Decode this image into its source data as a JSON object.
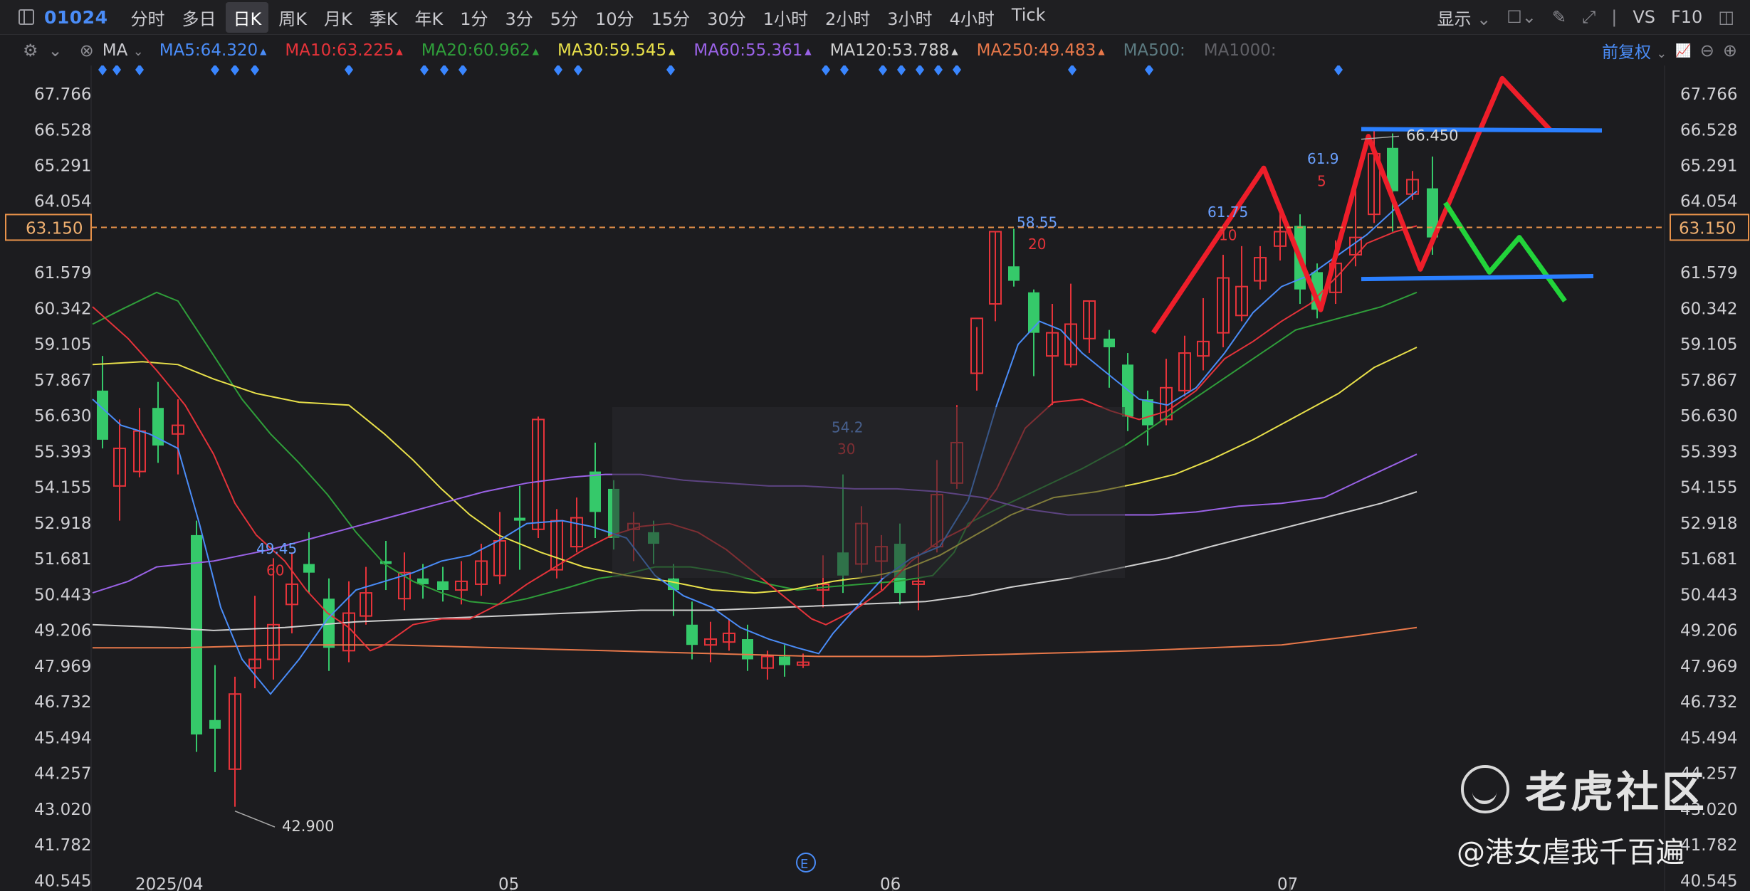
{
  "toolbar": {
    "code": "01024",
    "periods": [
      "分时",
      "多日",
      "日K",
      "周K",
      "月K",
      "季K",
      "年K",
      "1分",
      "3分",
      "5分",
      "10分",
      "15分",
      "30分",
      "1小时",
      "2小时",
      "3小时",
      "4小时",
      "Tick"
    ],
    "active_period": "日K",
    "display_label": "显示",
    "vs_label": "VS",
    "f10_label": "F10"
  },
  "ma_bar": {
    "indicator": "MA",
    "items": [
      {
        "label": "MA5:64.320",
        "color": "#4a8cf7"
      },
      {
        "label": "MA10:63.225",
        "color": "#e5333a"
      },
      {
        "label": "MA20:60.962",
        "color": "#2f9e3a"
      },
      {
        "label": "MA30:59.545",
        "color": "#e8e04a"
      },
      {
        "label": "MA60:55.361",
        "color": "#9a62e6"
      },
      {
        "label": "MA120:53.788",
        "color": "#cfcfcf"
      },
      {
        "label": "MA250:49.483",
        "color": "#e8784a"
      },
      {
        "label": "MA500:",
        "color": "#5c7a80"
      },
      {
        "label": "MA1000:",
        "color": "#606066"
      }
    ],
    "adjust": "前复权"
  },
  "price_axis": [
    "67.766",
    "66.528",
    "65.291",
    "64.054",
    "61.579",
    "60.342",
    "59.105",
    "57.867",
    "56.630",
    "55.393",
    "54.155",
    "52.918",
    "51.681",
    "50.443",
    "49.206",
    "47.969",
    "46.732",
    "45.494",
    "44.257",
    "43.020",
    "41.782",
    "40.545"
  ],
  "current_price": "63.150",
  "date_axis": [
    "2025/04",
    "05",
    "06",
    "07"
  ],
  "annotations": {
    "high": "66.450",
    "low": "42.900",
    "a1_v": "58.55",
    "a1_n": "20",
    "a2_v": "61.75",
    "a2_n": "10",
    "a3_v": "61.9",
    "a3_n": "5",
    "a4_v": "54.2",
    "a4_n": "30",
    "a5_v": "49.45",
    "a5_n": "60",
    "event": "E"
  },
  "watermark": {
    "brand": "老虎社区",
    "user": "@港女虐我千百遍"
  }
}
